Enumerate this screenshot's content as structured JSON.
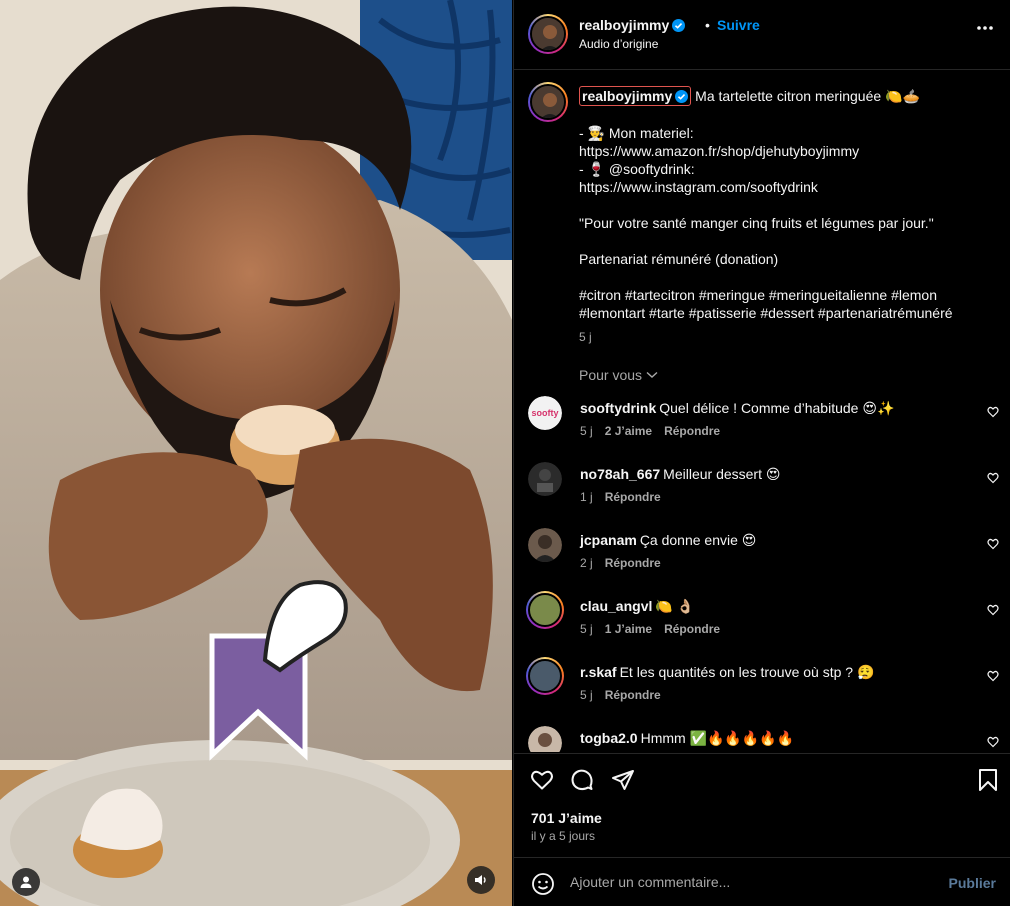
{
  "video": {
    "user_icon": "user-icon",
    "audio_icon": "speaker-icon"
  },
  "header": {
    "username": "realboyjimmy",
    "separator": "•",
    "follow_label": "Suivre",
    "subtitle": "Audio d’origine",
    "more_icon": "more-icon"
  },
  "caption": {
    "username": "realboyjimmy",
    "title": "Ma tartelette citron meringuée 🍋🥧",
    "lines": [
      "- 👨‍🍳 Mon materiel:",
      "https://www.amazon.fr/shop/djehutyboyjimmy",
      "- 🍷 @sooftydrink:",
      "https://www.instagram.com/sooftydrink",
      "",
      "\"Pour votre santé manger cinq fruits et légumes par jour.\"",
      "",
      "Partenariat rémunéré (donation)",
      "",
      "#citron #tartecitron #meringue #meringueitalienne #lemon",
      "#lemontart #tarte #patisserie #dessert #partenariatrémunéré"
    ],
    "time": "5 j"
  },
  "pour_vous": "Pour vous",
  "comments": [
    {
      "user": "sooftydrink",
      "text": "Quel délice ! Comme d’habitude 😍✨",
      "time": "5 j",
      "likes": "2 J’aime",
      "reply": "Répondre",
      "ring": false,
      "color": "#f2f2f2"
    },
    {
      "user": "no78ah_667",
      "text": "Meilleur dessert 😍",
      "time": "1 j",
      "likes": "",
      "reply": "Répondre",
      "ring": false,
      "color": "#2b2b2b"
    },
    {
      "user": "jcpanam",
      "text": "Ça donne envie 😍",
      "time": "2 j",
      "likes": "",
      "reply": "Répondre",
      "ring": false,
      "color": "#6b5a4c"
    },
    {
      "user": "clau_angvl",
      "text": "🍋 👌🏼",
      "time": "5 j",
      "likes": "1 J’aime",
      "reply": "Répondre",
      "ring": true,
      "color": "#7a8a4a"
    },
    {
      "user": "r.skaf",
      "text": "Et les quantités on les trouve où stp ? 😮‍💨",
      "time": "5 j",
      "likes": "",
      "reply": "Répondre",
      "ring": true,
      "color": "#4a5a6a"
    },
    {
      "user": "togba2.0",
      "text": "Hmmm ✅🔥🔥🔥🔥🔥",
      "time": "",
      "likes": "",
      "reply": "",
      "ring": false,
      "color": "#c8b8a8"
    }
  ],
  "actions": {
    "likes": "701 J’aime",
    "ago": "il y a 5 jours"
  },
  "add_comment": {
    "placeholder": "Ajouter un commentaire...",
    "publish": "Publier"
  }
}
